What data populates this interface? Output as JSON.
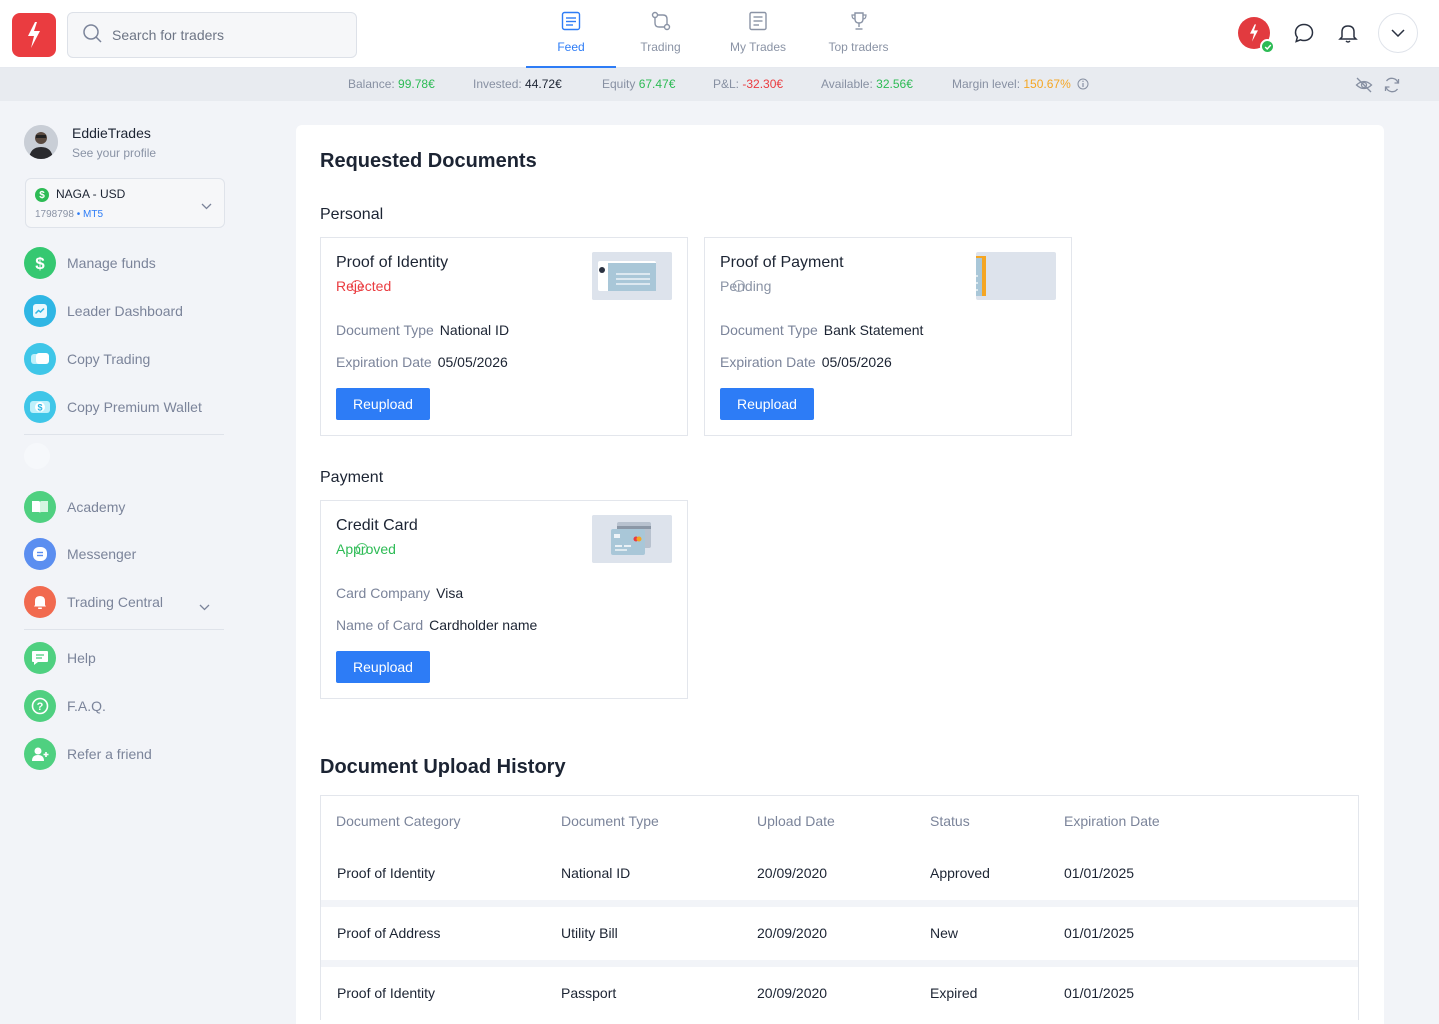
{
  "topbar": {
    "search_placeholder": "Search for traders",
    "nav": [
      {
        "label": "Feed",
        "icon": "feed-icon",
        "active": true
      },
      {
        "label": "Trading",
        "icon": "trading-icon",
        "active": false
      },
      {
        "label": "My Trades",
        "icon": "my-trades-icon",
        "active": false
      },
      {
        "label": "Top traders",
        "icon": "trophy-icon",
        "active": false
      }
    ]
  },
  "balance": {
    "balance_label": "Balance:",
    "balance_value": "99.78€",
    "invested_label": "Invested:",
    "invested_value": "44.72€",
    "equity_label": "Equity",
    "equity_value": "67.47€",
    "pnl_label": "P&L:",
    "pnl_value": "-32.30€",
    "available_label": "Available:",
    "available_value": "32.56€",
    "margin_label": "Margin level:",
    "margin_value": "150.67%"
  },
  "sidebar": {
    "username": "EddieTrades",
    "profile_link": "See your profile",
    "account_name": "NAGA - USD",
    "account_id": "1798798",
    "account_platform": "MT5",
    "items": [
      {
        "label": "Manage funds",
        "icon": "dollar-icon"
      },
      {
        "label": "Leader Dashboard",
        "icon": "dashboard-icon"
      },
      {
        "label": "Copy Trading",
        "icon": "copy-trading-icon"
      },
      {
        "label": "Copy Premium Wallet",
        "icon": "wallet-icon"
      },
      {
        "label": "Academy",
        "icon": "book-icon"
      },
      {
        "label": "Messenger",
        "icon": "messenger-icon"
      },
      {
        "label": "Trading Central",
        "icon": "bell-icon"
      },
      {
        "label": "Help",
        "icon": "chat-icon"
      },
      {
        "label": "F.A.Q.",
        "icon": "question-icon"
      },
      {
        "label": "Refer a friend",
        "icon": "add-user-icon"
      }
    ]
  },
  "main": {
    "title": "Requested Documents",
    "personal_heading": "Personal",
    "payment_heading": "Payment",
    "cards": [
      {
        "title": "Proof of Identity",
        "status": "Rejected",
        "k1": "Document Type",
        "v1": "National ID",
        "k2": "Expiration Date",
        "v2": "05/05/2026",
        "button": "Reupload"
      },
      {
        "title": "Proof of Payment",
        "status": "Pending",
        "k1": "Document Type",
        "v1": "Bank Statement",
        "k2": "Expiration Date",
        "v2": "05/05/2026",
        "button": "Reupload"
      },
      {
        "title": "Credit Card",
        "status": "Approved",
        "k1": "Card Company",
        "v1": "Visa",
        "k2": "Name of Card",
        "v2": "Cardholder name",
        "button": "Reupload"
      }
    ],
    "history_title": "Document Upload History",
    "columns": [
      "Document Category",
      "Document Type",
      "Upload Date",
      "Status",
      "Expiration Date"
    ],
    "rows": [
      [
        "Proof of Identity",
        "National ID",
        "20/09/2020",
        "Approved",
        "01/01/2025"
      ],
      [
        "Proof of Address",
        "Utility Bill",
        "20/09/2020",
        "New",
        "01/01/2025"
      ],
      [
        "Proof of Identity",
        "Passport",
        "20/09/2020",
        "Expired",
        "01/01/2025"
      ]
    ]
  },
  "colors": {
    "accent": "#2d7cf6",
    "brand": "#ea3c40",
    "approved": "#2dbb55",
    "rejected": "#ea3c40",
    "pending": "#8a93a5",
    "margin": "#f5a623"
  }
}
